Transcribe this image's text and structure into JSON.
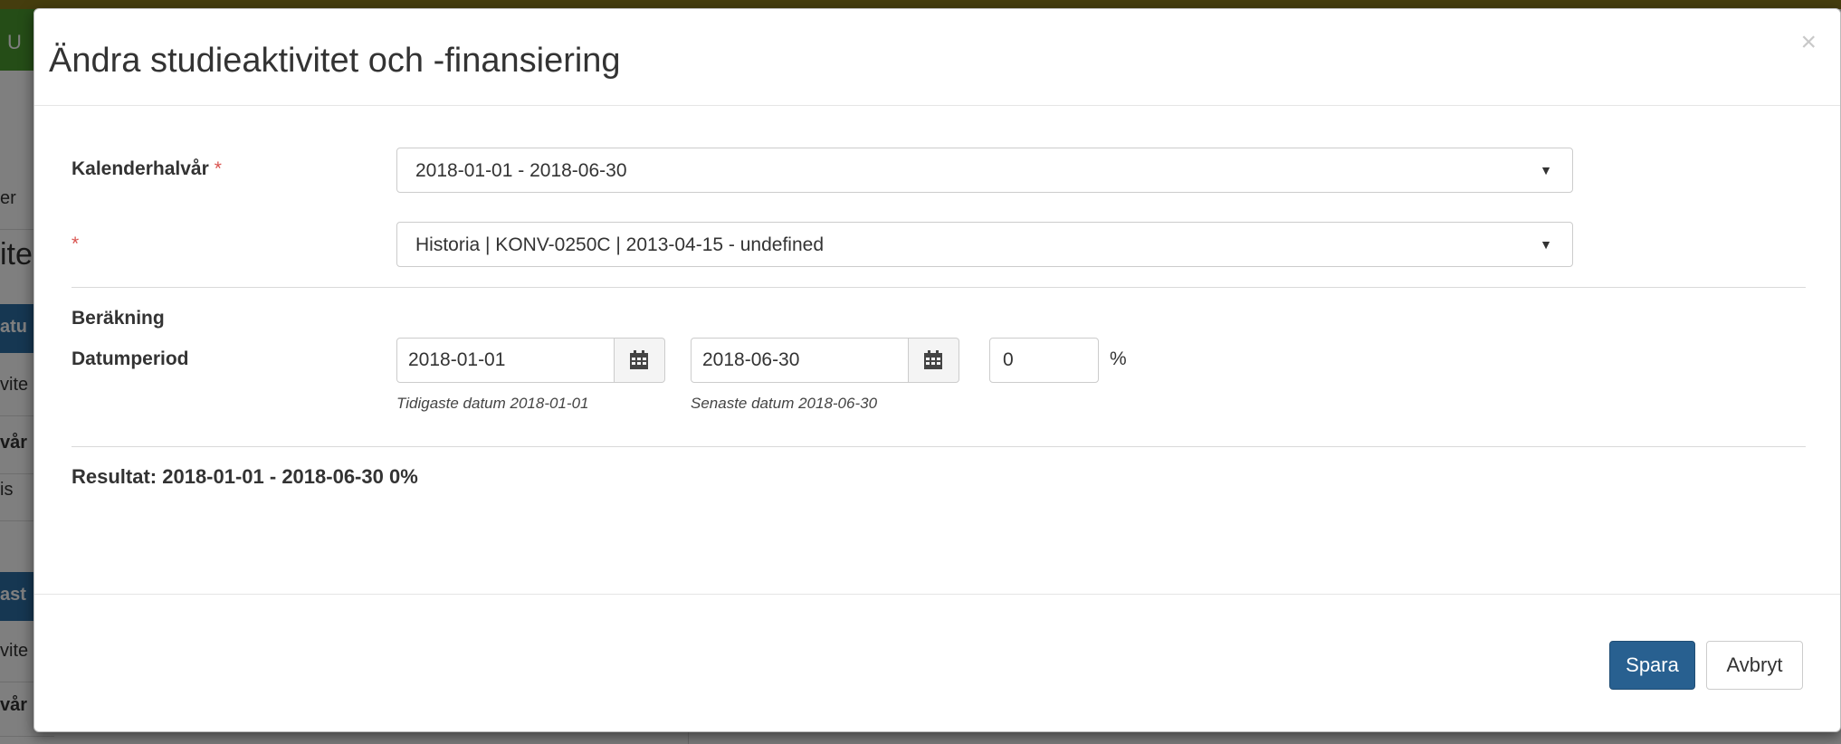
{
  "background": {
    "items": [
      "U",
      "er",
      "ite",
      "atu",
      "vite",
      "vår",
      "is",
      "ast",
      "vite",
      "vår"
    ]
  },
  "modal": {
    "title": "Ändra studieaktivitet och -finansiering",
    "close": "×",
    "calendar_half_year": {
      "label": "Kalenderhalvår",
      "required_mark": "*",
      "value": "2018-01-01 - 2018-06-30"
    },
    "activity": {
      "label": "",
      "required_mark": "*",
      "value": "Historia | KONV-0250C | 2013-04-15 - undefined"
    },
    "calculation": {
      "heading": "Beräkning",
      "period_label": "Datumperiod",
      "start_date": "2018-01-01",
      "end_date": "2018-06-30",
      "start_hint": "Tidigaste datum 2018-01-01",
      "end_hint": "Senaste datum 2018-06-30",
      "percent": "0",
      "percent_sign": "%"
    },
    "result": "Resultat: 2018-01-01 - 2018-06-30 0%",
    "buttons": {
      "save": "Spara",
      "cancel": "Avbryt"
    }
  },
  "colors": {
    "primary": "#286090",
    "required": "#d9534f",
    "green": "#4a9a2e"
  }
}
